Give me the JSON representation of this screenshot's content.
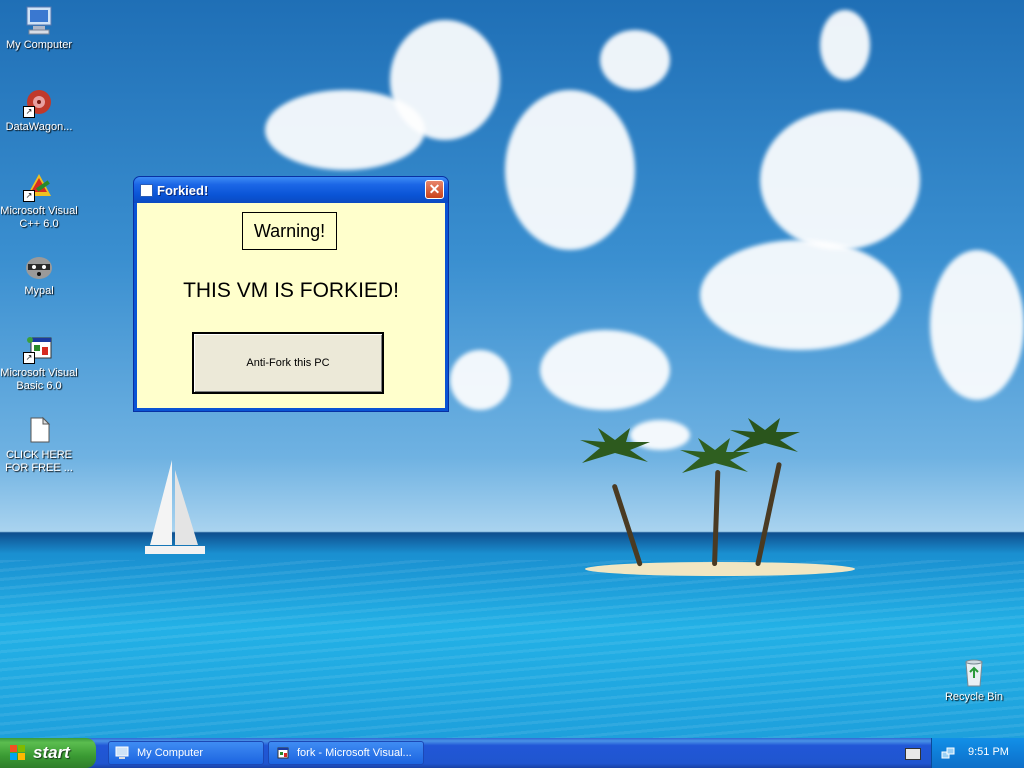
{
  "desktop": {
    "icons": [
      {
        "label": "My Computer",
        "icon": "computer-icon"
      },
      {
        "label": "DataWagon...",
        "icon": "datawagon-icon"
      },
      {
        "label": "Microsoft Visual C++ 6.0",
        "icon": "visual-cpp-icon"
      },
      {
        "label": "Mypal",
        "icon": "raccoon-browser-icon"
      },
      {
        "label": "Microsoft Visual Basic 6.0",
        "icon": "visual-basic-icon"
      },
      {
        "label": "CLICK HERE FOR FREE ...",
        "icon": "blank-document-icon"
      },
      {
        "label": "Recycle Bin",
        "icon": "recycle-bin-icon"
      }
    ]
  },
  "window": {
    "title": "Forkied!",
    "warning_label": "Warning!",
    "message": "THIS VM IS FORKIED!",
    "button_label": "Anti-Fork this PC",
    "close_glyph": "✕",
    "background_color": "#ffffcc"
  },
  "taskbar": {
    "start_label": "start",
    "tasks": [
      {
        "label": "My Computer",
        "icon": "computer-icon"
      },
      {
        "label": "fork - Microsoft Visual...",
        "icon": "visual-basic-icon"
      }
    ],
    "clock": "9:51 PM"
  },
  "colors": {
    "taskbar_blue": "#2157d7",
    "start_green": "#3a9a33",
    "close_red": "#c9421b"
  }
}
